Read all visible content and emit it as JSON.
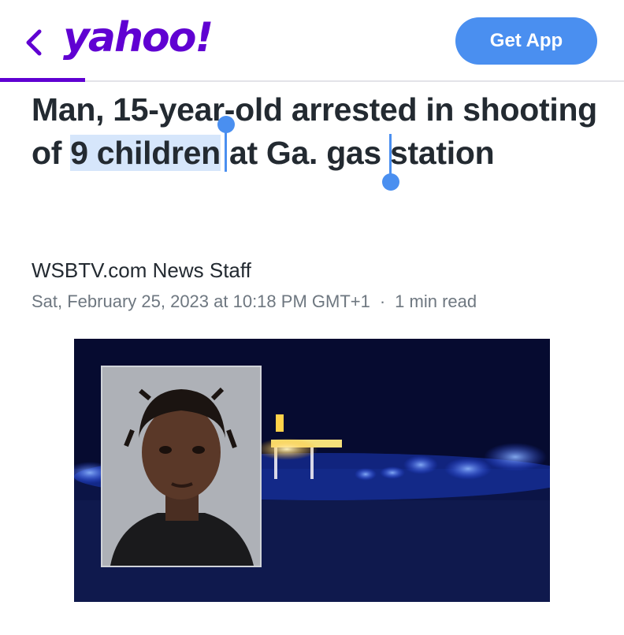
{
  "header": {
    "logo_text": "yahoo!",
    "get_app_label": "Get App",
    "accent_color": "#6001d2",
    "button_color": "#4a8ff0"
  },
  "article": {
    "headline_before": "Man, 15-year-old arrested in shooting of ",
    "headline_selected": "9 children",
    "headline_after": " at Ga. gas station",
    "author": "WSBTV.com News Staff",
    "date": "Sat, February 25, 2023 at 10:18 PM GMT+1",
    "separator": "·",
    "read_time": "1 min read"
  },
  "icons": {
    "back": "chevron-left-icon"
  }
}
